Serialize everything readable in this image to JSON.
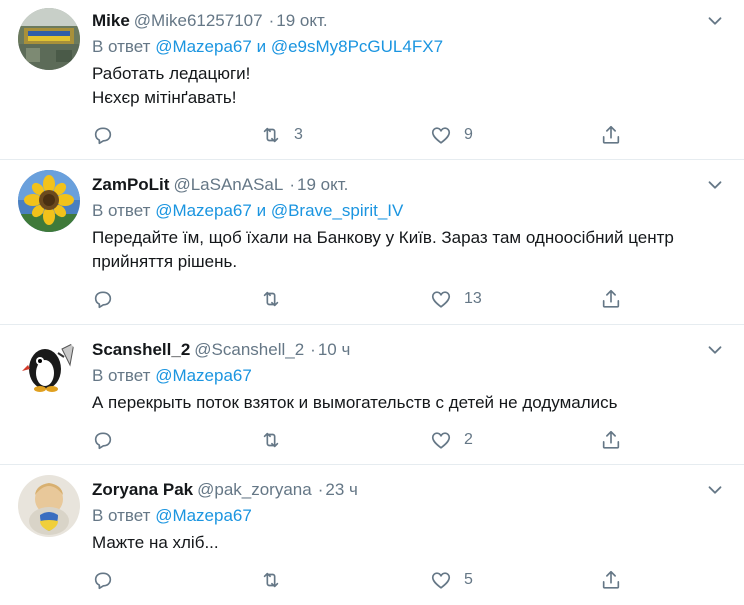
{
  "tweets": [
    {
      "name": "Mike",
      "handle": "@Mike61257107",
      "sep": "·",
      "time": "19 окт.",
      "reply_prefix": "В ответ",
      "mention1": "@Mazepa67",
      "conj": "и",
      "mention2": "@e9sMy8PcGUL4FX7",
      "line1": "Работать ледацюги!",
      "line2": "Нєхєр мітінґавать!",
      "retweets": "3",
      "likes": "9"
    },
    {
      "name": "ZamPoLit",
      "handle": "@LaSAnASaL",
      "sep": "·",
      "time": "19 окт.",
      "reply_prefix": "В ответ",
      "mention1": "@Mazepa67",
      "conj": "и",
      "mention2": "@Brave_spirit_IV",
      "line1": "Передайте їм, щоб їхали на Банкову у Київ. Зараз там одноосібний центр",
      "line2": "прийняття рішень.",
      "retweets": "",
      "likes": "13"
    },
    {
      "name": "Scanshell_2",
      "handle": "@Scanshell_2",
      "sep": "·",
      "time": "10 ч",
      "reply_prefix": "В ответ",
      "mention1": "@Mazepa67",
      "line1": "А перекрыть поток взяток и вымогательств с детей не додумались",
      "retweets": "",
      "likes": "2"
    },
    {
      "name": "Zoryana Pak",
      "handle": "@pak_zoryana",
      "sep": "·",
      "time": "23 ч",
      "reply_prefix": "В ответ",
      "mention1": "@Mazepa67",
      "line1": "Мажте на хліб...",
      "retweets": "",
      "likes": "5"
    }
  ],
  "colors": {
    "text": "#14171a",
    "secondary": "#657786",
    "link": "#1b95e0",
    "divider": "#e6ecf0"
  },
  "icons": [
    "reply-icon",
    "retweet-icon",
    "like-icon",
    "share-icon",
    "chevron-down-icon"
  ]
}
